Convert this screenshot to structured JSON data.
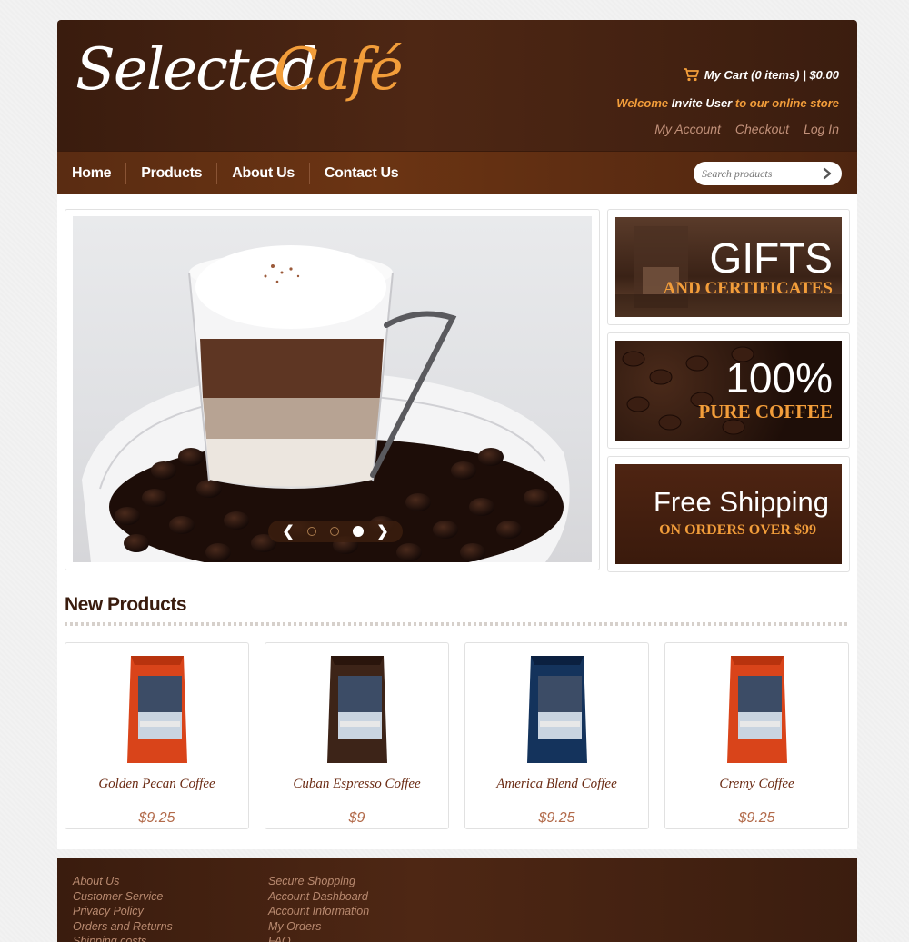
{
  "header": {
    "logo_word1": "Selected",
    "logo_word2": "Café",
    "cart_text": "My Cart (0 items) | $0.00",
    "welcome_prefix": "Welcome",
    "welcome_user": "Invite User",
    "welcome_suffix": "to our online store",
    "account_links": [
      "My Account",
      "Checkout",
      "Log In"
    ]
  },
  "nav": {
    "items": [
      "Home",
      "Products",
      "About Us",
      "Contact Us"
    ],
    "search_placeholder": "Search products"
  },
  "slider": {
    "prev": "❮",
    "next": "❯",
    "dots": 3,
    "active_dot": 3
  },
  "promos": [
    {
      "big": "GIFTS",
      "small": "AND CERTIFICATES"
    },
    {
      "big": "100%",
      "small": "PURE COFFEE"
    },
    {
      "big": "Free Shipping",
      "small": "ON ORDERS OVER $99"
    }
  ],
  "section": {
    "title": "New Products"
  },
  "products": [
    {
      "name": "Golden Pecan Coffee",
      "price": "$9.25",
      "bag_color": "#d9441a"
    },
    {
      "name": "Cuban Espresso Coffee",
      "price": "$9",
      "bag_color": "#3d2418"
    },
    {
      "name": "America Blend Coffee",
      "price": "$9.25",
      "bag_color": "#14335c"
    },
    {
      "name": "Cremy Coffee",
      "price": "$9.25",
      "bag_color": "#d9441a"
    }
  ],
  "footer": {
    "col1": [
      "About Us",
      "Customer Service",
      "Privacy Policy",
      "Orders and Returns",
      "Shipping costs"
    ],
    "col2": [
      "Secure Shopping",
      "Account Dashboard",
      "Account Information",
      "My Orders",
      "FAQ"
    ]
  },
  "colors": {
    "brand_dark": "#3a1c0e",
    "accent_orange": "#f29d3a",
    "price_color": "#b26a4a"
  }
}
